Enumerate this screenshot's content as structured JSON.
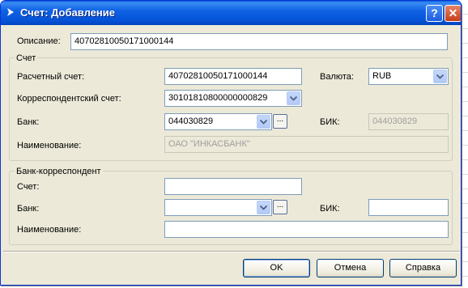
{
  "window": {
    "title": "Счет: Добавление",
    "help_glyph": "?",
    "close_glyph": "✕"
  },
  "form": {
    "description": {
      "label": "Описание:",
      "value": "40702810050171000144"
    }
  },
  "account_group": {
    "title": "Счет",
    "settlement": {
      "label": "Расчетный счет:",
      "value": "40702810050171000144"
    },
    "currency": {
      "label": "Валюта:",
      "value": "RUB"
    },
    "correspondent": {
      "label": "Корреспондентский счет:",
      "value": "30101810800000000829"
    },
    "bank": {
      "label": "Банк:",
      "value": "044030829",
      "browse": "..."
    },
    "bik": {
      "label": "БИК:",
      "value": "044030829"
    },
    "name": {
      "label": "Наименование:",
      "value": "ОАО \"ИНКАСБАНК\""
    }
  },
  "corr_bank_group": {
    "title": "Банк-корреспондент",
    "account": {
      "label": "Счет:",
      "value": ""
    },
    "bank": {
      "label": "Банк:",
      "value": "",
      "browse": "..."
    },
    "bik": {
      "label": "БИК:",
      "value": ""
    },
    "name": {
      "label": "Наименование:",
      "value": ""
    }
  },
  "buttons": {
    "ok": "OK",
    "cancel": "Отмена",
    "help": "Справка"
  },
  "colors": {
    "titlebar": "#0553d8",
    "dialog": "#ece9d8",
    "border": "#7f9db9"
  }
}
